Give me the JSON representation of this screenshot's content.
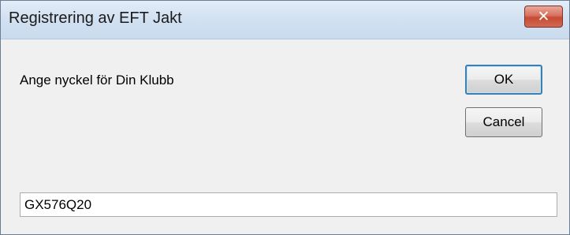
{
  "window": {
    "title": "Registrering av EFT Jakt",
    "close_icon": "close-icon"
  },
  "dialog": {
    "prompt": "Ange nyckel för Din Klubb",
    "ok_label": "OK",
    "cancel_label": "Cancel",
    "key_value": "GX576Q20"
  },
  "colors": {
    "titlebar": "#d4e2f2",
    "close_button": "#c74b34",
    "background": "#f0f0f0",
    "default_button_border": "#3c7fb1"
  }
}
